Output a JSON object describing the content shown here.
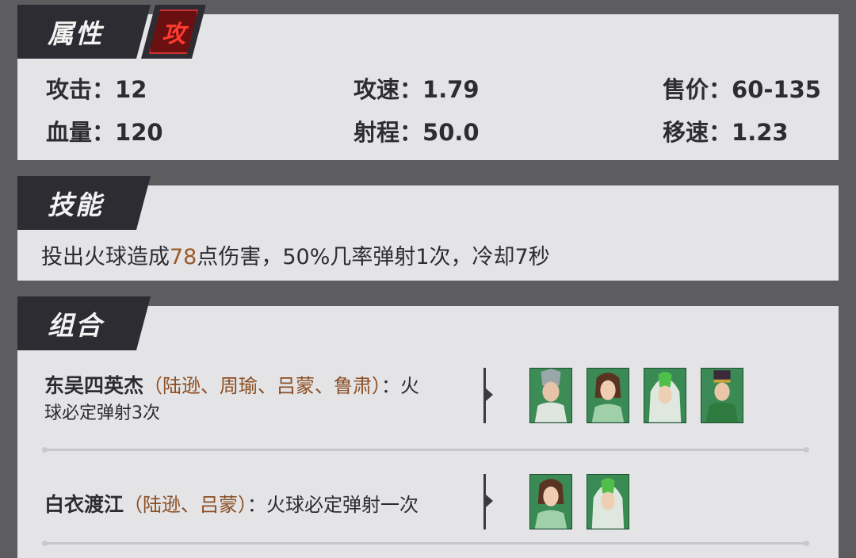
{
  "attributes": {
    "section_title": "属性",
    "type_badge": "攻",
    "attack_label": "攻击：",
    "attack_value": "12",
    "hp_label": "血量：",
    "hp_value": "120",
    "atk_speed_label": "攻速：",
    "atk_speed_value": "1.79",
    "range_label": "射程：",
    "range_value": "50.0",
    "price_label": "售价：",
    "price_value": "60-135",
    "move_speed_label": "移速：",
    "move_speed_value": "1.23"
  },
  "skill": {
    "section_title": "技能",
    "text_before": "投出火球造成",
    "damage": "78",
    "text_after": "点伤害，50%几率弹射1次，冷却7秒"
  },
  "combos": {
    "section_title": "组合",
    "items": [
      {
        "name": "东吴四英杰",
        "members": "（陆逊、周瑜、吕蒙、鲁肃）",
        "effect_line1": "：火",
        "effect_line2": "球必定弹射3次",
        "avatars": [
          "armored-warrior-icon",
          "brown-hair-hero-icon",
          "green-hood-hero-icon",
          "crowned-general-icon"
        ]
      },
      {
        "name": "白衣渡江",
        "members": "（陆逊、吕蒙）",
        "effect": "：火球必定弹射一次",
        "avatars": [
          "brown-hair-hero-icon",
          "green-hood-hero-icon"
        ]
      }
    ]
  },
  "colors": {
    "panel_bg": "#e4e4e6",
    "tab_bg": "#2e2c33",
    "highlight": "#9a5a2a",
    "badge_red": "#ff3b30"
  }
}
